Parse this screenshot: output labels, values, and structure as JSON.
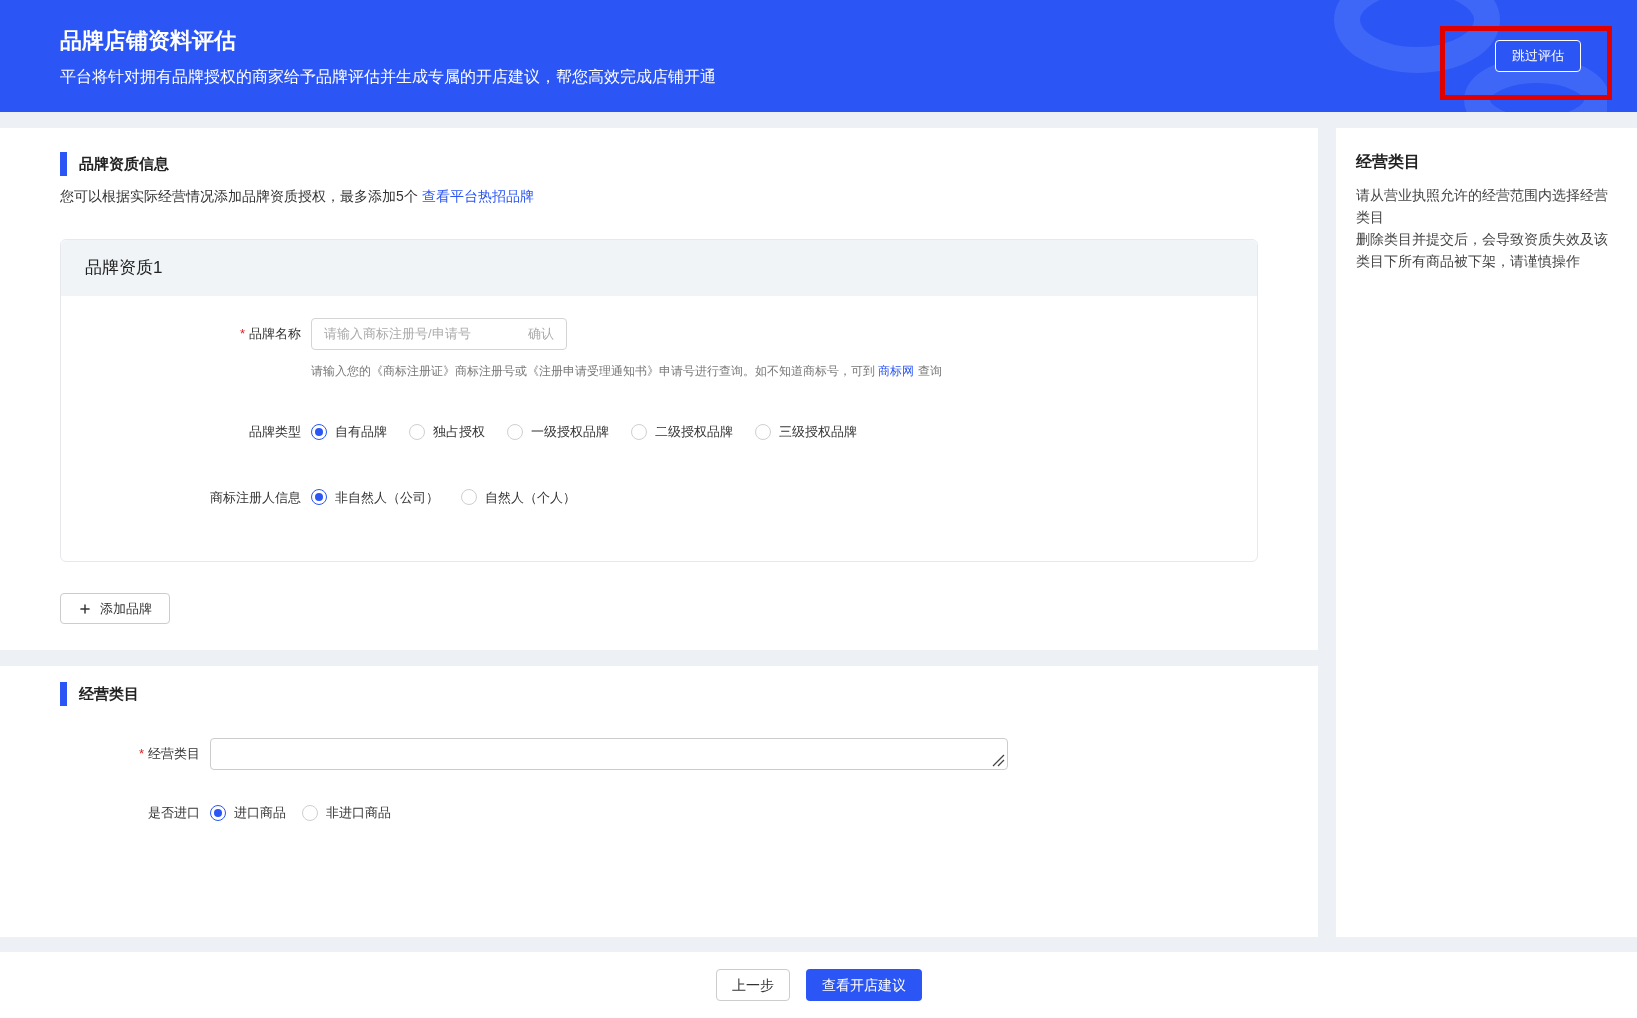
{
  "header": {
    "title": "品牌店铺资料评估",
    "subtitle": "平台将针对拥有品牌授权的商家给予品牌评估并生成专属的开店建议，帮您高效完成店铺开通",
    "skip_button": "跳过评估",
    "highlighted": true
  },
  "brand_section": {
    "title": "品牌资质信息",
    "description": "您可以根据实际经营情况添加品牌资质授权，最多添加5个",
    "description_link": "查看平台热招品牌",
    "card": {
      "title": "品牌资质1",
      "brand_name": {
        "label": "品牌名称",
        "required": true,
        "required_mark": "*",
        "placeholder": "请输入商标注册号/申请号",
        "confirm": "确认",
        "hint": "请输入您的《商标注册证》商标注册号或《注册申请受理通知书》申请号进行查询。如不知道商标号，可到",
        "hint_link": "商标网",
        "hint_after": "查询"
      },
      "brand_type": {
        "label": "品牌类型",
        "options": [
          {
            "label": "自有品牌",
            "selected": true
          },
          {
            "label": "独占授权",
            "selected": false
          },
          {
            "label": "一级授权品牌",
            "selected": false
          },
          {
            "label": "二级授权品牌",
            "selected": false
          },
          {
            "label": "三级授权品牌",
            "selected": false
          }
        ]
      },
      "registrant": {
        "label": "商标注册人信息",
        "options": [
          {
            "label": "非自然人（公司）",
            "selected": true
          },
          {
            "label": "自然人（个人）",
            "selected": false
          }
        ]
      }
    },
    "add_button": "添加品牌"
  },
  "category_section": {
    "title": "经营类目",
    "category": {
      "label": "经营类目",
      "required": true,
      "required_mark": "*"
    },
    "import": {
      "label": "是否进口",
      "options": [
        {
          "label": "进口商品",
          "selected": true
        },
        {
          "label": "非进口商品",
          "selected": false
        }
      ]
    }
  },
  "side_panel": {
    "title": "经营类目",
    "lines": [
      "请从营业执照允许的经营范围内选择经营类目",
      "删除类目并提交后，会导致资质失效及该类目下所有商品被下架，请谨慎操作"
    ]
  },
  "footer": {
    "back_button": "上一步",
    "next_button": "查看开店建议"
  }
}
